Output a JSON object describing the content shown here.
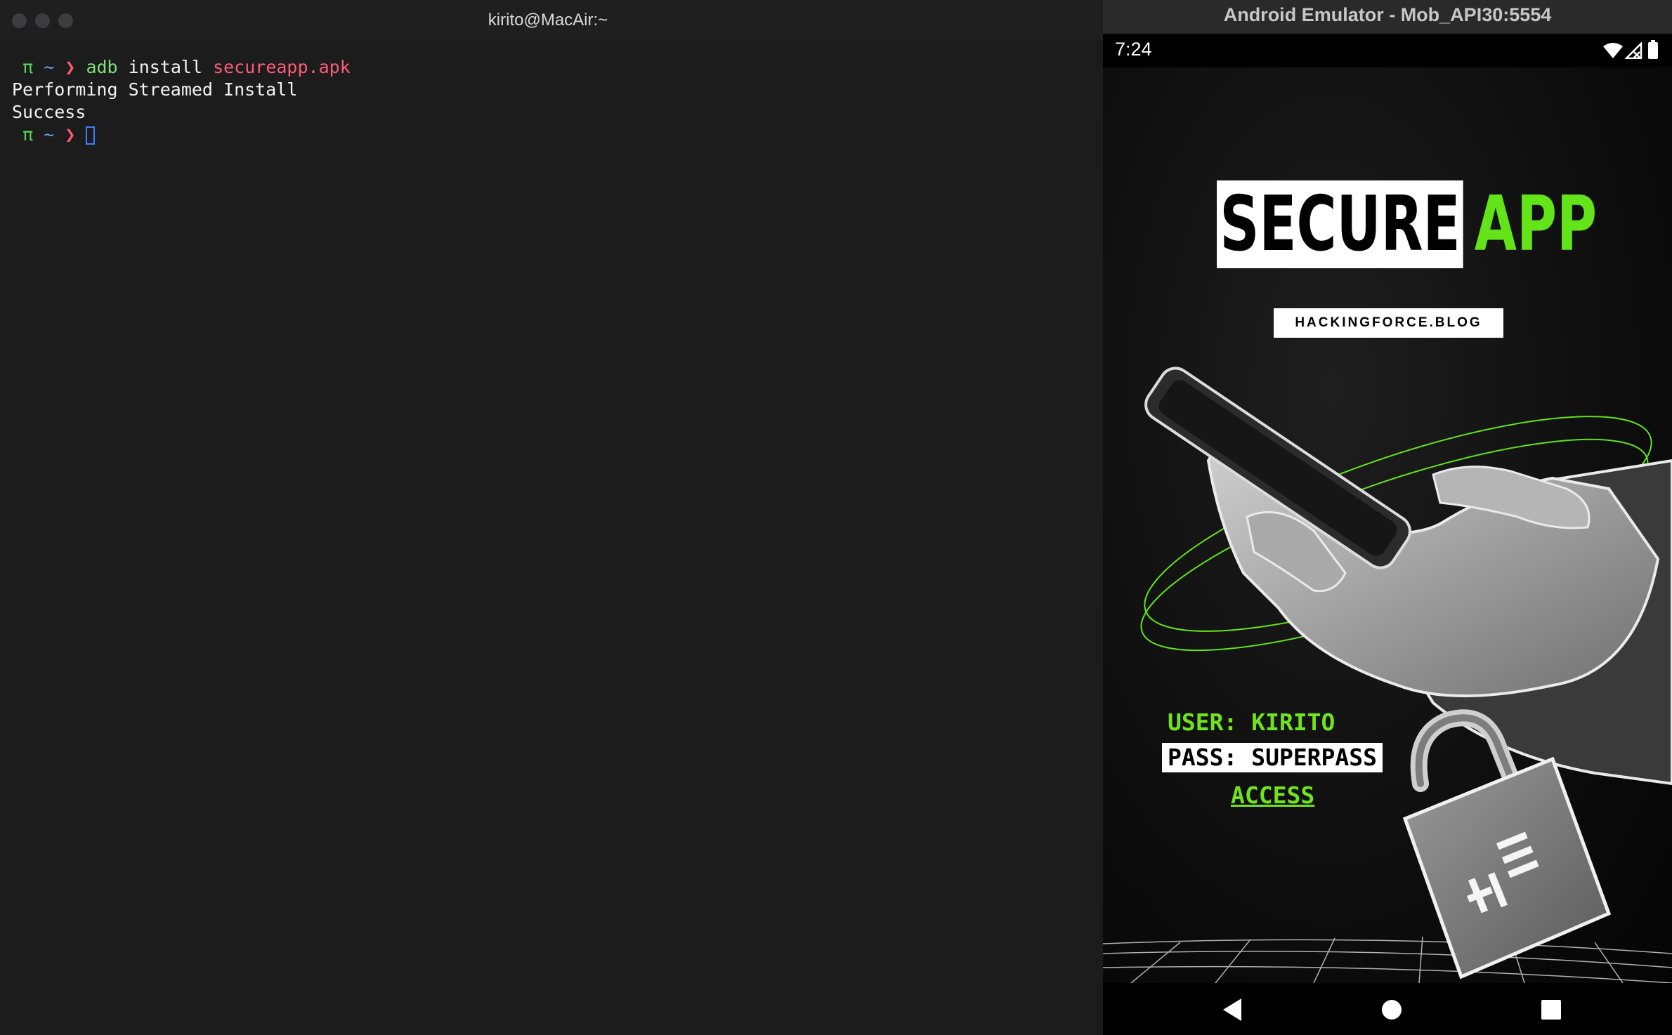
{
  "terminal": {
    "title": "kirito@MacAir:~",
    "prompt": {
      "pi": "π",
      "tilde": "~",
      "arrow": "❯"
    },
    "command": {
      "program": "adb",
      "subcommand": "install",
      "argument": "secureapp.apk"
    },
    "output": [
      "Performing Streamed Install",
      "Success"
    ]
  },
  "emulator": {
    "title": "Android Emulator - Mob_API30:5554",
    "status_bar": {
      "time": "7:24",
      "icons": [
        "wifi-icon",
        "signal-icon",
        "battery-icon"
      ]
    },
    "app": {
      "title_word1": "SECURE",
      "title_word2": "APP",
      "badge": "HACKINGFORCE.BLOG",
      "user_line": "USER: KIRITO",
      "pass_line": "PASS: SUPERPASS",
      "access_link": "ACCESS"
    },
    "nav_bar": [
      "back-icon",
      "home-icon",
      "recents-icon"
    ]
  },
  "colors": {
    "accent_green": "#63e418",
    "terminal_bg": "#1c1c1d",
    "prompt_red": "#ff5b6b",
    "cursor_blue": "#3f7dff"
  }
}
